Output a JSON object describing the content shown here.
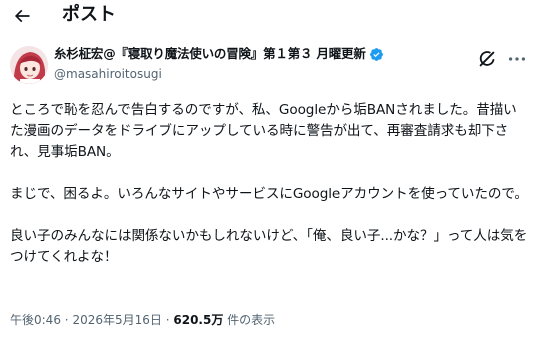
{
  "header": {
    "title": "ポスト",
    "back_icon": "arrow-left-icon"
  },
  "author": {
    "display_name": "糸杉柾宏@『寝取り魔法使いの冒険』第１第３ 月曜更新",
    "handle": "@masahiroitosugi",
    "verified_color": "#1d9bf0"
  },
  "tweet": {
    "paragraphs": [
      "ところで恥を忍んで告白するのですが、私、Googleから垢BANされました。昔描いた漫画のデータをドライブにアップしている時に警告が出て、再審査請求も却下され、見事垢BAN。",
      "まじで、困るよ。いろんなサイトやサービスにGoogleアカウントを使っていたので。",
      "良い子のみんなには関係ないかもしれないけど、「俺、良い子...かな？」って人は気をつけてくれよな！"
    ]
  },
  "meta": {
    "time": "午後0:46",
    "separator": "·",
    "date": "2026年5月16日",
    "views_count": "620.5万",
    "views_label": "件の表示"
  },
  "icons": {
    "grok": "grok-icon",
    "more": "more-icon",
    "verified": "verified-badge-icon"
  }
}
